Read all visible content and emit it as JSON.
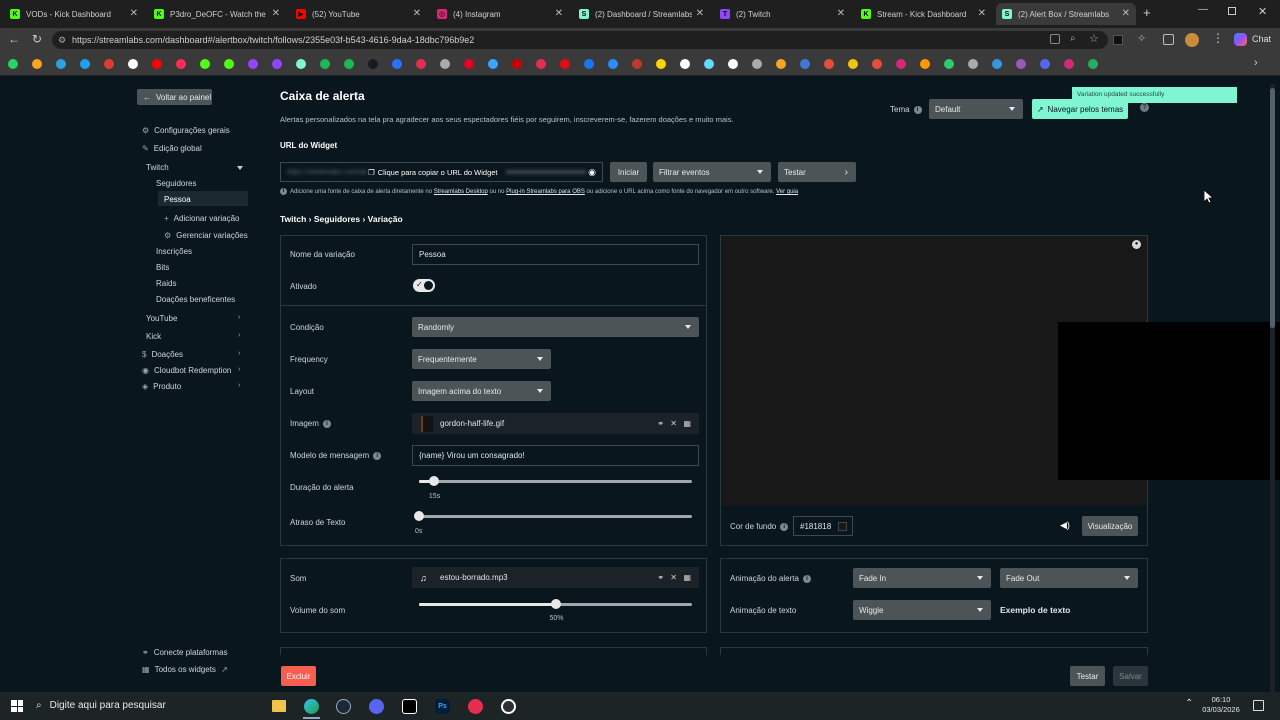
{
  "tabs": [
    {
      "label": "VODs - Kick Dashboard",
      "icon_color": "#53fc18",
      "glyph": "K"
    },
    {
      "label": "P3dro_DeOFC - Watch the V",
      "icon_color": "#53fc18",
      "glyph": "K"
    },
    {
      "label": "(52) YouTube",
      "icon_color": "#ff0000",
      "glyph": "▶"
    },
    {
      "label": "(4) Instagram",
      "icon_color": "#d62976",
      "glyph": "◎"
    },
    {
      "label": "(2) Dashboard / Streamlabs",
      "icon_color": "#80f5d2",
      "glyph": "S"
    },
    {
      "label": "(2) Twitch",
      "icon_color": "#9146ff",
      "glyph": "T"
    },
    {
      "label": "Stream - Kick Dashboard",
      "icon_color": "#53fc18",
      "glyph": "K"
    },
    {
      "label": "(2) Alert Box / Streamlabs",
      "icon_color": "#80f5d2",
      "glyph": "S"
    }
  ],
  "browser": {
    "url": "https://streamlabs.com/dashboard#/alertbox/twitch/follows/2355e03f-b543-4616-9da4-18dbc796b9e2",
    "chat_label": "Chat"
  },
  "sidebar": {
    "back_label": "Voltar ao painel",
    "items": [
      {
        "label": "Configurações gerais",
        "icon": "gear-icon"
      },
      {
        "label": "Edição global",
        "icon": "edit-icon"
      }
    ],
    "twitch_label": "Twitch",
    "seguidores_label": "Seguidores",
    "pessoa_label": "Pessoa",
    "add_variation_label": "Adicionar variação",
    "manage_variations_label": "Gerenciar variações",
    "twitch_sub": [
      "Inscrições",
      "Bits",
      "Raids",
      "Doações beneficentes"
    ],
    "youtube_label": "YouTube",
    "kick_label": "Kick",
    "bottom_items": [
      {
        "label": "Doações",
        "icon": "dollar-icon"
      },
      {
        "label": "Cloudbot Redemption",
        "icon": "bot-icon"
      },
      {
        "label": "Produto",
        "icon": "tag-icon"
      }
    ],
    "connect_label": "Conecte plataformas",
    "all_widgets_label": "Todos os widgets"
  },
  "header": {
    "title": "Caixa de alerta",
    "description": "Alertas personalizados na tela pra agradecer aos seus espectadores fiéis por seguirem, inscreverem-se, fazerem doações e muito mais.",
    "theme_label": "Tema",
    "theme_value": "Default",
    "browse_themes_label": "Navegar pelos temas",
    "toast": "Variation updated successfully"
  },
  "widget_url": {
    "label": "URL do Widget",
    "blurred": "https://streamlabs.com/alert-box/v3/••••••••••••••••••••••",
    "copy_label": "Clique para copiar o URL do Widget",
    "start_label": "Iniciar",
    "filter_label": "Filtrar eventos",
    "test_label": "Testar",
    "hint_pre": "Adicione uma fonte de caixa de alerta diretamente no ",
    "hint_link1": "Streamlabs Desktop",
    "hint_mid1": " ou no ",
    "hint_link2": "Plug-in Streamlabs para OBS",
    "hint_mid2": " ou adicione o URL acima como fonte do navegador em outro software. ",
    "hint_link3": "Ver guia"
  },
  "breadcrumb": "Twitch › Seguidores › Variação",
  "form": {
    "name_label": "Nome da variação",
    "name_value": "Pessoa",
    "enabled_label": "Ativado",
    "enabled": true,
    "condition_label": "Condição",
    "condition_value": "Randomly",
    "frequency_label": "Frequency",
    "frequency_value": "Frequentemente",
    "layout_label": "Layout",
    "layout_value": "Imagem acima do texto",
    "image_label": "Imagem",
    "image_value": "gordon-half-life.gif",
    "message_label": "Modelo de mensagem",
    "message_value": "{name} Virou um consagrado!",
    "duration_label": "Duração do alerta",
    "duration_value": "15s",
    "duration_fraction": 0.04,
    "text_delay_label": "Atraso de Texto",
    "text_delay_value": "0s",
    "text_delay_fraction": 0.0
  },
  "preview": {
    "bg_label": "Cor de fundo",
    "bg_value": "#181818",
    "preview_button": "Visualização"
  },
  "sound": {
    "label": "Som",
    "value": "estou-borrado.mp3",
    "volume_label": "Volume do som",
    "volume_value": "50%",
    "volume_fraction": 0.5
  },
  "animation": {
    "alert_anim_label": "Animação do alerta",
    "in_value": "Fade In",
    "out_value": "Fade Out",
    "text_anim_label": "Animação de texto",
    "text_anim_value": "Wiggle",
    "example_label": "Exemplo de texto"
  },
  "footer": {
    "delete_label": "Excluir",
    "test_label": "Testar",
    "save_label": "Salvar"
  },
  "taskbar": {
    "search_placeholder": "Digite aqui para pesquisar",
    "time": "06:10",
    "date": "03/03/2026"
  }
}
